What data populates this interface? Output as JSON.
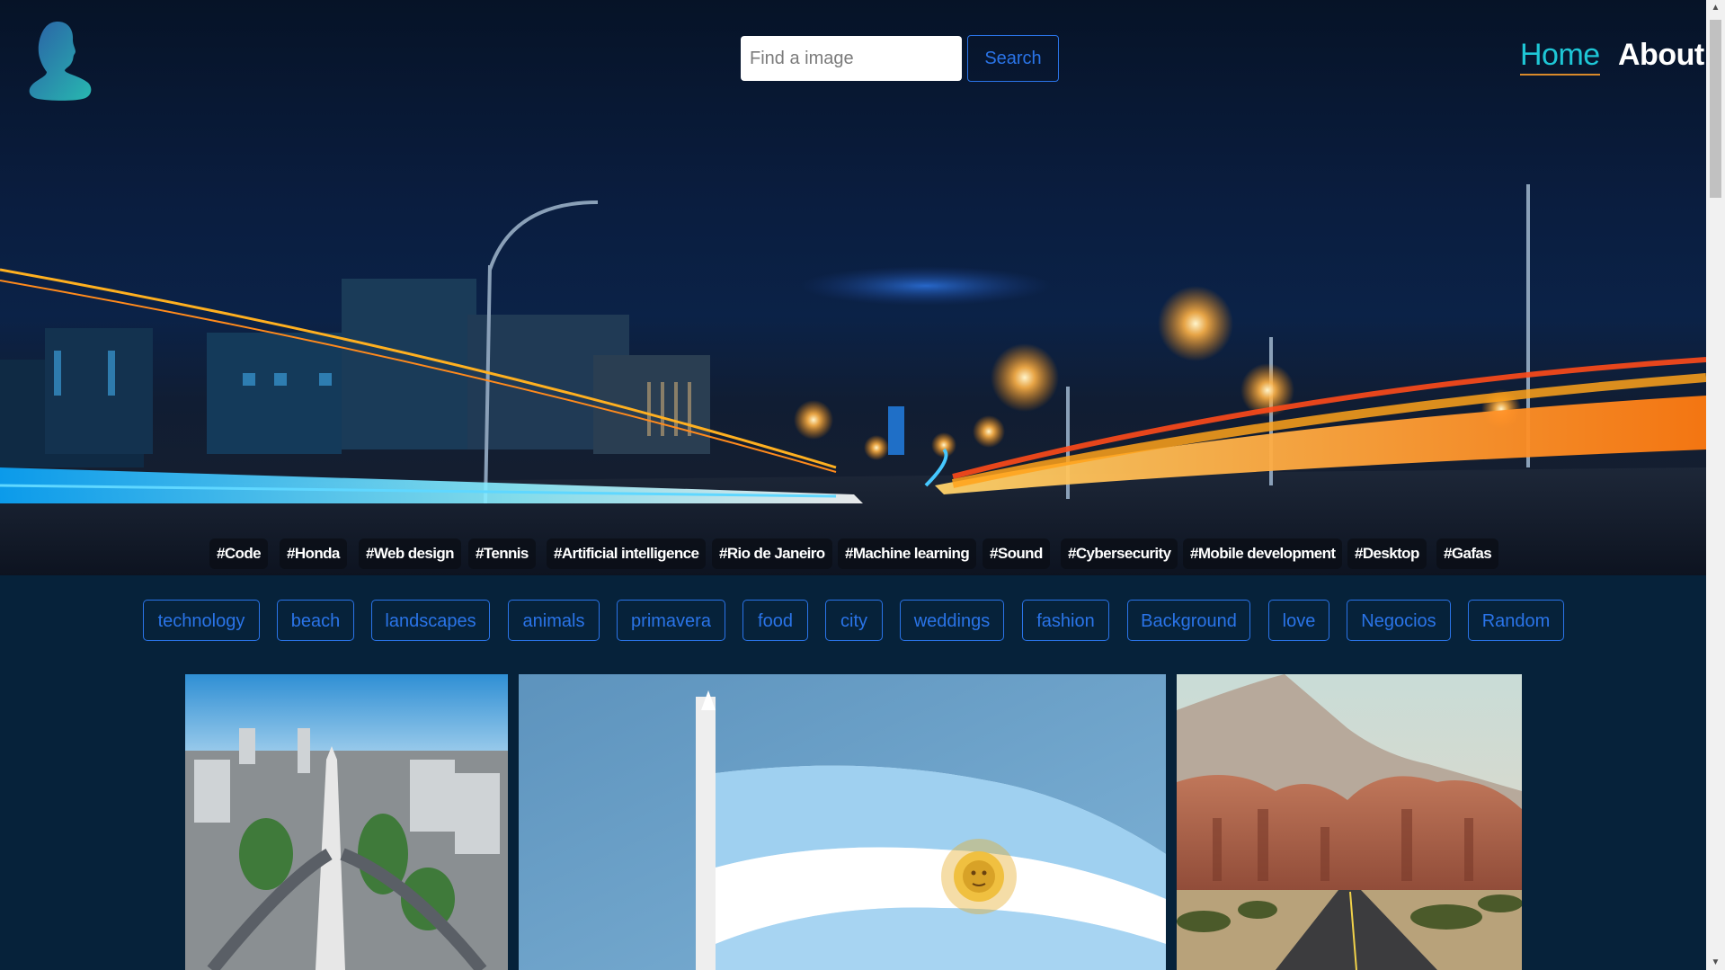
{
  "header": {
    "search": {
      "placeholder": "Find a image",
      "button_label": "Search"
    },
    "nav": {
      "home_label": "Home",
      "about_label": "About"
    }
  },
  "hashtags": [
    "#Code",
    "#Honda",
    "#Web design",
    "#Tennis",
    "#Artificial intelligence",
    "#Rio de Janeiro",
    "#Machine learning",
    "#Sound",
    "#Cybersecurity",
    "#Mobile development",
    "#Desktop",
    "#Gafas"
  ],
  "categories": [
    "technology",
    "beach",
    "landscapes",
    "animals",
    "primavera",
    "food",
    "city",
    "weddings",
    "fashion",
    "Background",
    "love",
    "Negocios",
    "Random"
  ],
  "colors": {
    "accent": "#2a74e8",
    "nav_active": "#1ec7d6",
    "background": "#06223a"
  },
  "icons": [
    "user-silhouette-icon",
    "chevron-up-icon",
    "chevron-down-icon"
  ]
}
